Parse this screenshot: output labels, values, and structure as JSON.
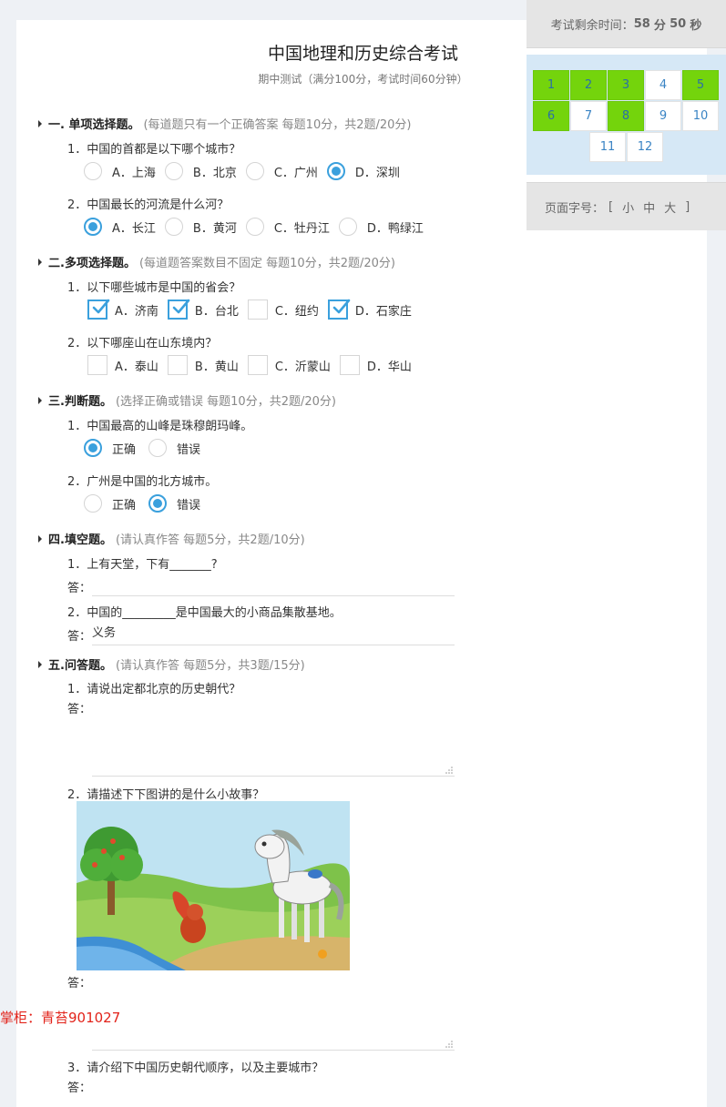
{
  "exam": {
    "title": "中国地理和历史综合考试",
    "subtitle": "期中测试（满分100分，考试时间60分钟）"
  },
  "timer": {
    "label": "考试剩余时间：",
    "minutes": "58",
    "min_unit": "分",
    "seconds": "50",
    "sec_unit": "秒"
  },
  "nav": {
    "items": [
      {
        "label": "1",
        "answered": true
      },
      {
        "label": "2",
        "answered": true
      },
      {
        "label": "3",
        "answered": true
      },
      {
        "label": "4",
        "answered": false
      },
      {
        "label": "5",
        "answered": true
      },
      {
        "label": "6",
        "answered": true
      },
      {
        "label": "7",
        "answered": false
      },
      {
        "label": "8",
        "answered": true
      },
      {
        "label": "9",
        "answered": false
      },
      {
        "label": "10",
        "answered": false
      },
      {
        "label": "11",
        "answered": false
      },
      {
        "label": "12",
        "answered": false
      }
    ],
    "answered_color": "#74d40c"
  },
  "font_size": {
    "label": "页面字号：",
    "open": "[",
    "small": "小",
    "medium": "中",
    "large": "大",
    "close": "]"
  },
  "sections": {
    "s1": {
      "title": "一. 单项选择题。",
      "hint": "(每道题只有一个正确答案 每题10分，共2题/20分)"
    },
    "s2": {
      "title": "二.多项选择题。",
      "hint": "(每道题答案数目不固定 每题10分，共2题/20分)"
    },
    "s3": {
      "title": "三.判断题。",
      "hint": "(选择正确或错误 每题10分，共2题/20分)"
    },
    "s4": {
      "title": "四.填空题。",
      "hint": "(请认真作答 每题5分，共2题/10分)"
    },
    "s5": {
      "title": "五.问答题。",
      "hint": "(请认真作答 每题5分，共3题/15分)"
    }
  },
  "questions": {
    "q1": {
      "text": "1．中国的首都是以下哪个城市？",
      "options": [
        "A．上海",
        "B．北京",
        "C．广州",
        "D．深圳"
      ],
      "selected": "D"
    },
    "q2": {
      "text": "2．中国最长的河流是什么河？",
      "options": [
        "A．长江",
        "B．黄河",
        "C．牡丹江",
        "D．鸭绿江"
      ],
      "selected": "A"
    },
    "q3": {
      "text": "1．以下哪些城市是中国的省会？",
      "options": [
        "A．济南",
        "B．台北",
        "C．纽约",
        "D．石家庄"
      ],
      "checked": [
        "A",
        "B",
        "D"
      ]
    },
    "q4": {
      "text": "2．以下哪座山在山东境内？",
      "options": [
        "A．泰山",
        "B．黄山",
        "C．沂蒙山",
        "D．华山"
      ],
      "checked": []
    },
    "q5": {
      "text": "1．中国最高的山峰是珠穆朗玛峰。",
      "options": [
        "正确",
        "错误"
      ],
      "selected": "正确"
    },
    "q6": {
      "text": "2．广州是中国的北方城市。",
      "options": [
        "正确",
        "错误"
      ],
      "selected": "错误"
    },
    "q7": {
      "text": "1．上有天堂，下有_______?",
      "answer_label": "答：",
      "answer": ""
    },
    "q8": {
      "text": "2．中国的_________是中国最大的小商品集散基地。",
      "answer_label": "答：",
      "answer": "义务"
    },
    "q9": {
      "text": "1．请说出定都北京的历史朝代？",
      "answer_label": "答："
    },
    "q10": {
      "text": "2．请描述下下图讲的是什么小故事？",
      "answer_label": "答：",
      "image": "horse-and-squirrel-by-river"
    },
    "q11": {
      "text": "3．请介绍下中国历史朝代顺序，以及主要城市？",
      "answer_label": "答："
    }
  },
  "watermark": "掌柜：青苔901027",
  "colors": {
    "accent": "#3aa0dd",
    "answered": "#74d40c",
    "nav_bg": "#d6e8f6",
    "watermark": "#e2231a"
  }
}
